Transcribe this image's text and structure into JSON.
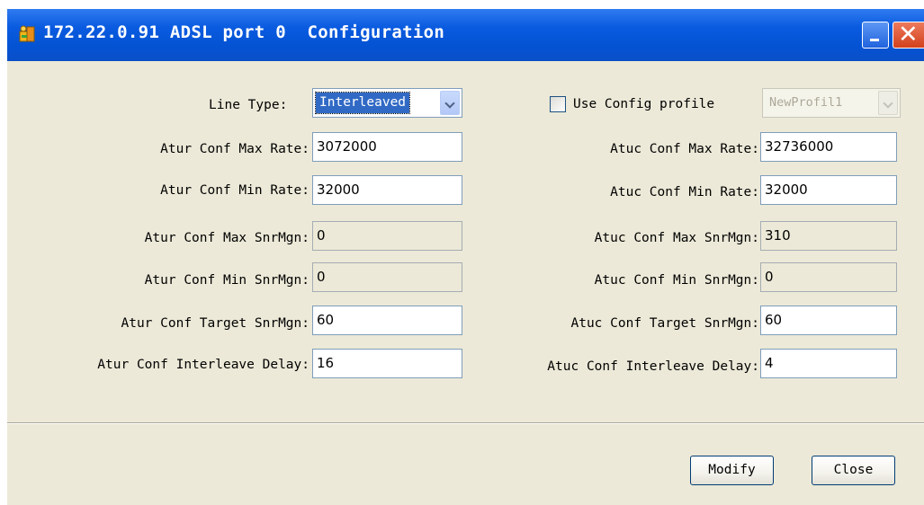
{
  "window": {
    "title": "172.22.0.91 ADSL port 0  Configuration"
  },
  "form": {
    "line_type_label": "Line Type:",
    "line_type_value": "Interleaved",
    "use_profile_label": "Use Config profile",
    "use_profile_checked": false,
    "profile_value": "NewProfil1",
    "atur": [
      {
        "label": "Atur Conf Max Rate:",
        "value": "3072000",
        "editable": true
      },
      {
        "label": "Atur Conf Min Rate:",
        "value": "32000",
        "editable": true
      },
      {
        "label": "Atur Conf Max SnrMgn:",
        "value": "0",
        "editable": false
      },
      {
        "label": "Atur Conf Min SnrMgn:",
        "value": "0",
        "editable": false
      },
      {
        "label": "Atur Conf Target SnrMgn:",
        "value": "60",
        "editable": true
      },
      {
        "label": "Atur Conf Interleave Delay:",
        "value": "16",
        "editable": true
      }
    ],
    "atuc": [
      {
        "label": "Atuc Conf Max Rate:",
        "value": "32736000",
        "editable": true
      },
      {
        "label": "Atuc Conf Min Rate:",
        "value": "32000",
        "editable": true
      },
      {
        "label": "Atuc Conf Max SnrMgn:",
        "value": "310",
        "editable": false
      },
      {
        "label": "Atuc Conf Min SnrMgn:",
        "value": "0",
        "editable": false
      },
      {
        "label": "Atuc Conf Target SnrMgn:",
        "value": "60",
        "editable": true
      },
      {
        "label": "Atuc Conf Interleave Delay:",
        "value": "4",
        "editable": true
      }
    ]
  },
  "buttons": {
    "modify": "Modify",
    "close": "Close"
  },
  "colors": {
    "titlebar": "#0453d4",
    "dialog_bg": "#ece9d8",
    "selection": "#316ac5"
  }
}
